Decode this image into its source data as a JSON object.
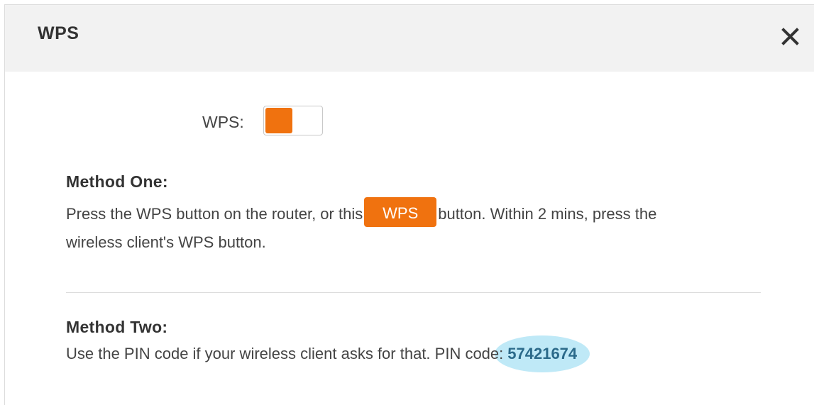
{
  "dialog": {
    "title": "WPS",
    "close_icon": "close-icon"
  },
  "wps_toggle": {
    "label": "WPS:",
    "state": "on",
    "accent_color": "#f0720f"
  },
  "method_one": {
    "heading": "Method One:",
    "text_before": "Press the WPS button on the router, or this",
    "button_label": "WPS",
    "text_after": "button. Within 2 mins, press the",
    "text_line2": "wireless client's WPS button."
  },
  "method_two": {
    "heading": "Method Two:",
    "text": "Use the PIN code if your wireless client asks for that. PIN code:",
    "pin_code": "57421674",
    "highlight_color": "#bfe9f7"
  }
}
